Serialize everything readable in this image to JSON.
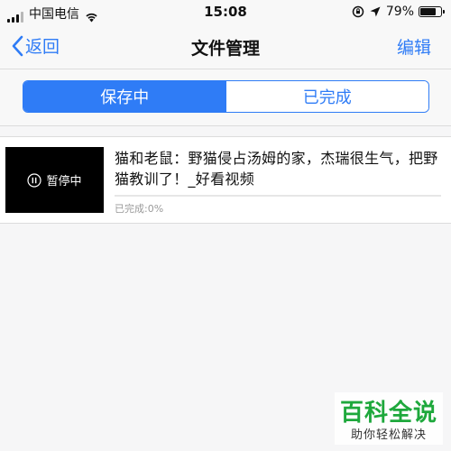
{
  "status_bar": {
    "carrier": "中国电信",
    "time": "15:08",
    "battery_percent": "79%",
    "battery_level": 0.79,
    "icons": [
      "signal-icon",
      "wifi-icon",
      "orientation-lock-icon",
      "location-icon",
      "battery-icon"
    ]
  },
  "nav": {
    "back_label": "返回",
    "title": "文件管理",
    "edit_label": "编辑"
  },
  "segments": {
    "active": "保存中",
    "inactive": "已完成"
  },
  "download_item": {
    "thumbnail_label": "暂停中",
    "title": "猫和老鼠：野猫侵占汤姆的家，杰瑞很生气，把野猫教训了！_好看视频",
    "progress_text": "已完成:0%",
    "progress": 0
  },
  "watermark": {
    "line1": "百科全说",
    "line2": "助你轻松解决"
  },
  "colors": {
    "accent": "#2f7cf6",
    "watermark_green": "#1ea83c"
  }
}
